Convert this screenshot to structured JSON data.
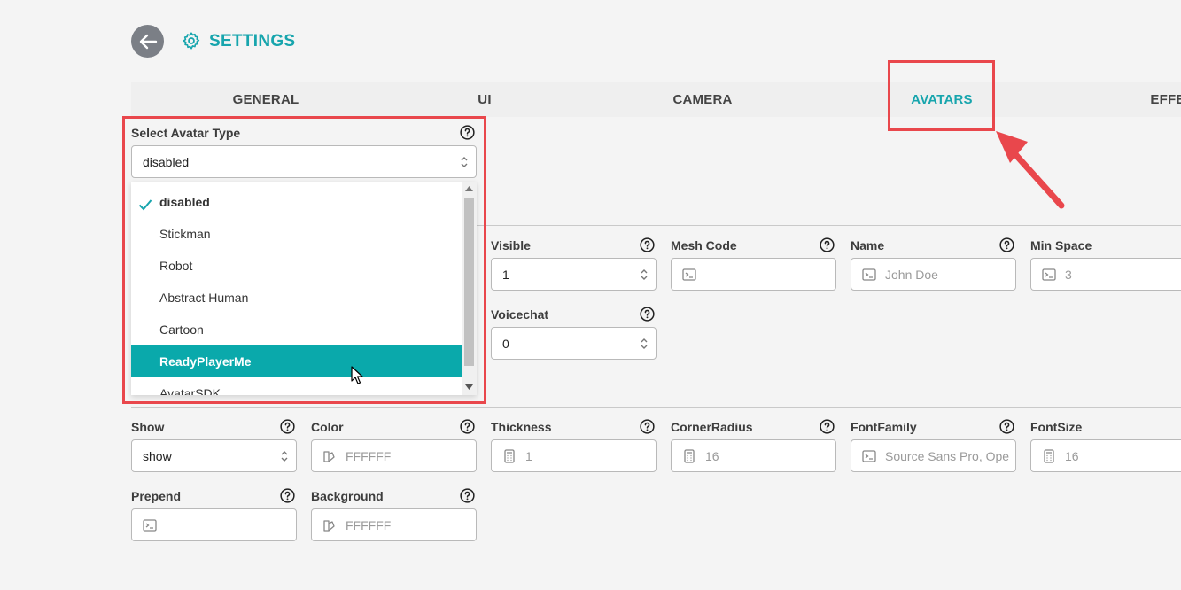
{
  "header": {
    "title": "SETTINGS"
  },
  "tabs": [
    {
      "label": "GENERAL"
    },
    {
      "label": "UI"
    },
    {
      "label": "CAMERA"
    },
    {
      "label": "AVATARS",
      "active": true
    },
    {
      "label": "EFFE"
    }
  ],
  "avatar_type": {
    "label": "Select Avatar Type",
    "value": "disabled",
    "options": [
      "disabled",
      "Stickman",
      "Robot",
      "Abstract Human",
      "Cartoon",
      "ReadyPlayerMe",
      "AvatarSDK"
    ],
    "selected": "disabled",
    "highlighted": "ReadyPlayerMe"
  },
  "avatar_fields": {
    "visible": {
      "label": "Visible",
      "value": "1"
    },
    "mesh_code": {
      "label": "Mesh Code",
      "placeholder": ""
    },
    "name": {
      "label": "Name",
      "placeholder": "John Doe"
    },
    "min_space": {
      "label": "Min Space",
      "placeholder": "3"
    },
    "voicechat": {
      "label": "Voicechat",
      "value": "0"
    }
  },
  "label_fields": {
    "show": {
      "label": "Show",
      "value": "show"
    },
    "color": {
      "label": "Color",
      "placeholder": "FFFFFF"
    },
    "thickness": {
      "label": "Thickness",
      "placeholder": "1"
    },
    "corner_radius": {
      "label": "CornerRadius",
      "placeholder": "16"
    },
    "font_family": {
      "label": "FontFamily",
      "placeholder": "Source Sans Pro, Ope"
    },
    "font_size": {
      "label": "FontSize",
      "placeholder": "16"
    },
    "prepend": {
      "label": "Prepend",
      "placeholder": ""
    },
    "background": {
      "label": "Background",
      "placeholder": "FFFFFF"
    }
  },
  "colors": {
    "accent": "#17a5ad",
    "highlight": "#0aa9ab",
    "annotation": "#e9474c"
  }
}
